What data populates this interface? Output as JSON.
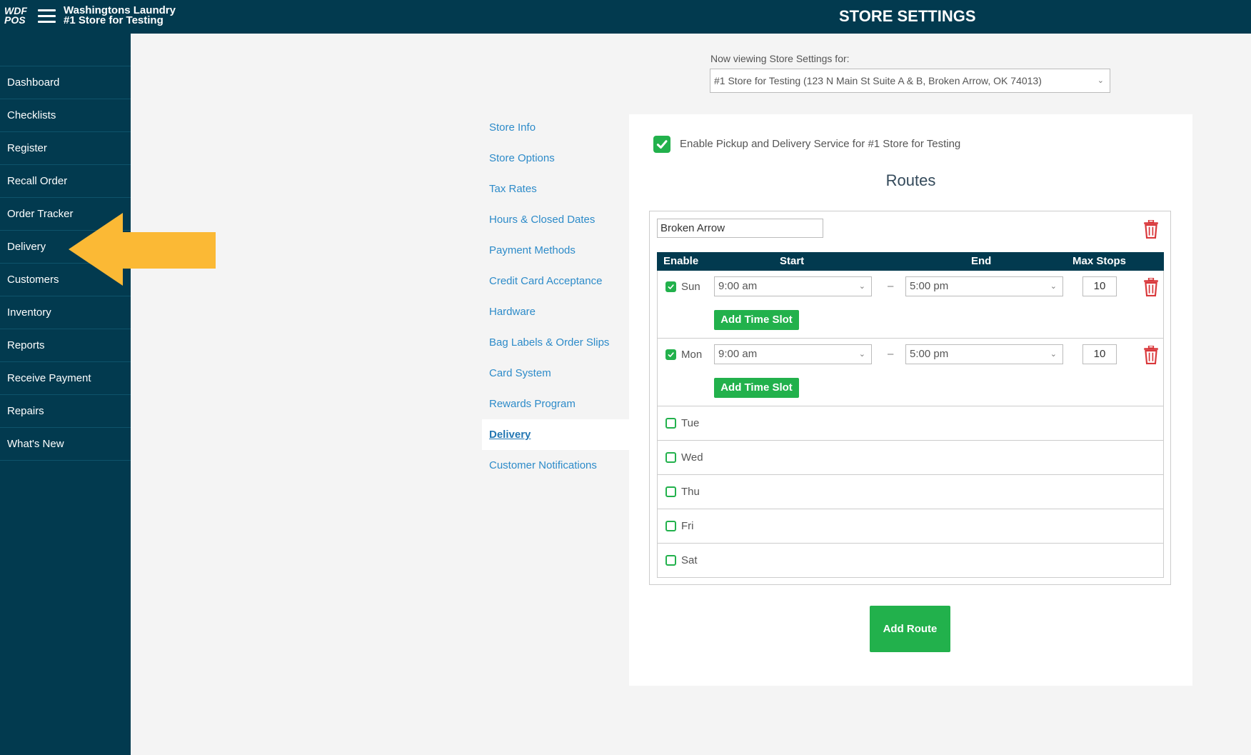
{
  "header": {
    "logo_line1": "WDF",
    "logo_line2": "POS",
    "store_line1": "Washingtons Laundry",
    "store_line2": "#1 Store for Testing",
    "title": "STORE SETTINGS"
  },
  "sidebar": {
    "items": [
      {
        "label": "Dashboard"
      },
      {
        "label": "Checklists"
      },
      {
        "label": "Register"
      },
      {
        "label": "Recall Order"
      },
      {
        "label": "Order Tracker"
      },
      {
        "label": "Delivery"
      },
      {
        "label": "Customers"
      },
      {
        "label": "Inventory"
      },
      {
        "label": "Reports"
      },
      {
        "label": "Receive Payment"
      },
      {
        "label": "Repairs"
      },
      {
        "label": "What's New"
      }
    ]
  },
  "store_selector": {
    "label": "Now viewing Store Settings for:",
    "value": "#1 Store for Testing (123 N Main St Suite A & B, Broken Arrow, OK 74013)"
  },
  "settings_nav": {
    "items": [
      {
        "label": "Store Info"
      },
      {
        "label": "Store Options"
      },
      {
        "label": "Tax Rates"
      },
      {
        "label": "Hours & Closed Dates"
      },
      {
        "label": "Payment Methods"
      },
      {
        "label": "Credit Card Acceptance"
      },
      {
        "label": "Hardware"
      },
      {
        "label": "Bag Labels & Order Slips"
      },
      {
        "label": "Card System"
      },
      {
        "label": "Rewards Program"
      },
      {
        "label": "Delivery"
      },
      {
        "label": "Customer Notifications"
      }
    ],
    "active": "Delivery"
  },
  "delivery": {
    "enable_label": "Enable Pickup and Delivery Service for #1 Store for Testing",
    "enabled": true,
    "routes_title": "Routes",
    "route": {
      "name": "Broken Arrow",
      "headers": {
        "enable": "Enable",
        "start": "Start",
        "end": "End",
        "max_stops": "Max Stops"
      },
      "days": [
        {
          "day": "Sun",
          "enabled": true,
          "start": "9:00 am",
          "end": "5:00 pm",
          "max_stops": "10",
          "add_slot": "Add Time Slot"
        },
        {
          "day": "Mon",
          "enabled": true,
          "start": "9:00 am",
          "end": "5:00 pm",
          "max_stops": "10",
          "add_slot": "Add Time Slot"
        },
        {
          "day": "Tue",
          "enabled": false
        },
        {
          "day": "Wed",
          "enabled": false
        },
        {
          "day": "Thu",
          "enabled": false
        },
        {
          "day": "Fri",
          "enabled": false
        },
        {
          "day": "Sat",
          "enabled": false
        }
      ],
      "dash": "–"
    },
    "add_route_label": "Add Route"
  },
  "colors": {
    "navy": "#023a4f",
    "green": "#22b14c",
    "link_blue": "#2d8bc9",
    "arrow_yellow": "#fbb935",
    "trash_red": "#d9373a"
  }
}
